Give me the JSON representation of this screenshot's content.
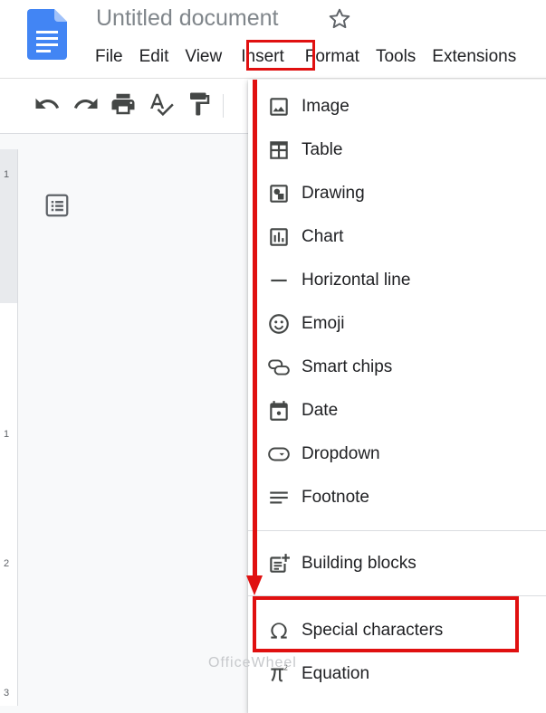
{
  "document": {
    "title": "Untitled document"
  },
  "menubar": {
    "items": [
      "File",
      "Edit",
      "View",
      "Insert",
      "Format",
      "Tools",
      "Extensions"
    ]
  },
  "insert_menu": {
    "items": [
      {
        "label": "Image",
        "icon": "image-icon"
      },
      {
        "label": "Table",
        "icon": "table-icon"
      },
      {
        "label": "Drawing",
        "icon": "drawing-icon"
      },
      {
        "label": "Chart",
        "icon": "chart-icon"
      },
      {
        "label": "Horizontal line",
        "icon": "horizontal-line-icon"
      },
      {
        "label": "Emoji",
        "icon": "emoji-icon"
      },
      {
        "label": "Smart chips",
        "icon": "smart-chips-icon"
      },
      {
        "label": "Date",
        "icon": "calendar-icon"
      },
      {
        "label": "Dropdown",
        "icon": "dropdown-icon"
      },
      {
        "label": "Footnote",
        "icon": "footnote-icon"
      },
      {
        "label": "Building blocks",
        "icon": "building-blocks-icon"
      },
      {
        "label": "Special characters",
        "icon": "omega-icon"
      },
      {
        "label": "Equation",
        "icon": "pi-icon"
      }
    ]
  },
  "ruler": {
    "labels": [
      "1",
      "1",
      "2",
      "3"
    ]
  },
  "watermark": {
    "text": "OfficeWheel"
  },
  "colors": {
    "annotation_red": "#e01010",
    "docs_blue": "#4285f4"
  }
}
